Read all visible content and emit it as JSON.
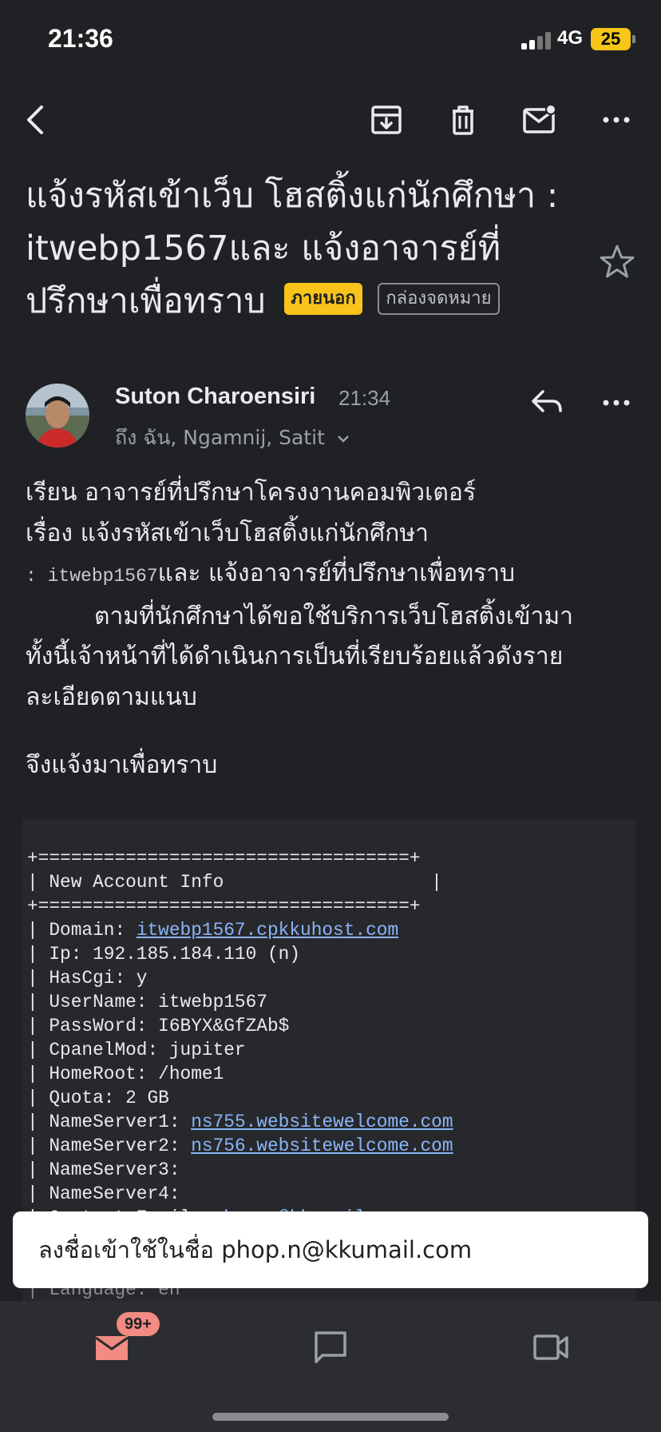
{
  "status": {
    "time": "21:36",
    "network": "4G",
    "battery": "25"
  },
  "email": {
    "subject": "แจ้งรหัสเข้าเว็บ โฮสติ้งแก่นักศึกษา : itwebp1567และ แจ้งอาจารย์ที่ปรึกษาเพื่อทราบ",
    "labels": {
      "outside": "ภายนอก",
      "inbox": "กล่องจดหมาย"
    },
    "sender": {
      "name": "Suton Charoensiri",
      "time": "21:34",
      "recipients": "ถึง ฉัน, Ngamnij, Satit"
    },
    "body": {
      "line1": "เรียน อาจารย์ที่ปรึกษาโครงงานคอมพิวเตอร์",
      "line2": "เรื่อง แจ้งรหัสเข้าเว็บโฮสติ้งแก่นักศึกษา",
      "line3_prefix": ": ",
      "line3_mono": "itwebp1567",
      "line3_rest": "และ แจ้งอาจารย์ที่ปรึกษาเพื่อทราบ",
      "line4": "ตามที่นักศึกษาได้ขอใช้บริการเว็บโฮสติ้งเข้ามา",
      "line5": "ทั้งนี้เจ้าหน้าที่ได้ดำเนินการเป็นที่เรียบร้อยแล้วดังราย",
      "line6": "ละเอียดตามแนบ",
      "closing": "จึงแจ้งมาเพื่อทราบ"
    },
    "account": {
      "border": "+==================================+",
      "header": "| New Account Info                   |",
      "domain_label": "| Domain: ",
      "domain": "itwebp1567.cpkkuhost.com",
      "ip": "| Ip: 192.185.184.110 (n)",
      "hascgi": "| HasCgi: y",
      "username": "| UserName: itwebp1567",
      "password": "| PassWord: I6BYX&GfZAb$",
      "cpanelmod": "| CpanelMod: jupiter",
      "homeroot": "| HomeRoot: /home1",
      "quota": "| Quota: 2 GB",
      "ns1_label": "| NameServer1: ",
      "ns1": "ns755.websitewelcome.com",
      "ns2_label": "| NameServer2: ",
      "ns2": "ns756.websitewelcome.com",
      "ns3": "| NameServer3:",
      "ns4": "| NameServer4:",
      "contact_label": "| Contact Email: ",
      "contact": "phop.n@kkumail.com",
      "language": "| Language: en"
    }
  },
  "toast": {
    "text": "ลงชื่อเข้าใช้ในชื่อ phop.n@kkumail.com"
  },
  "bottom_nav": {
    "mail_badge": "99+"
  }
}
